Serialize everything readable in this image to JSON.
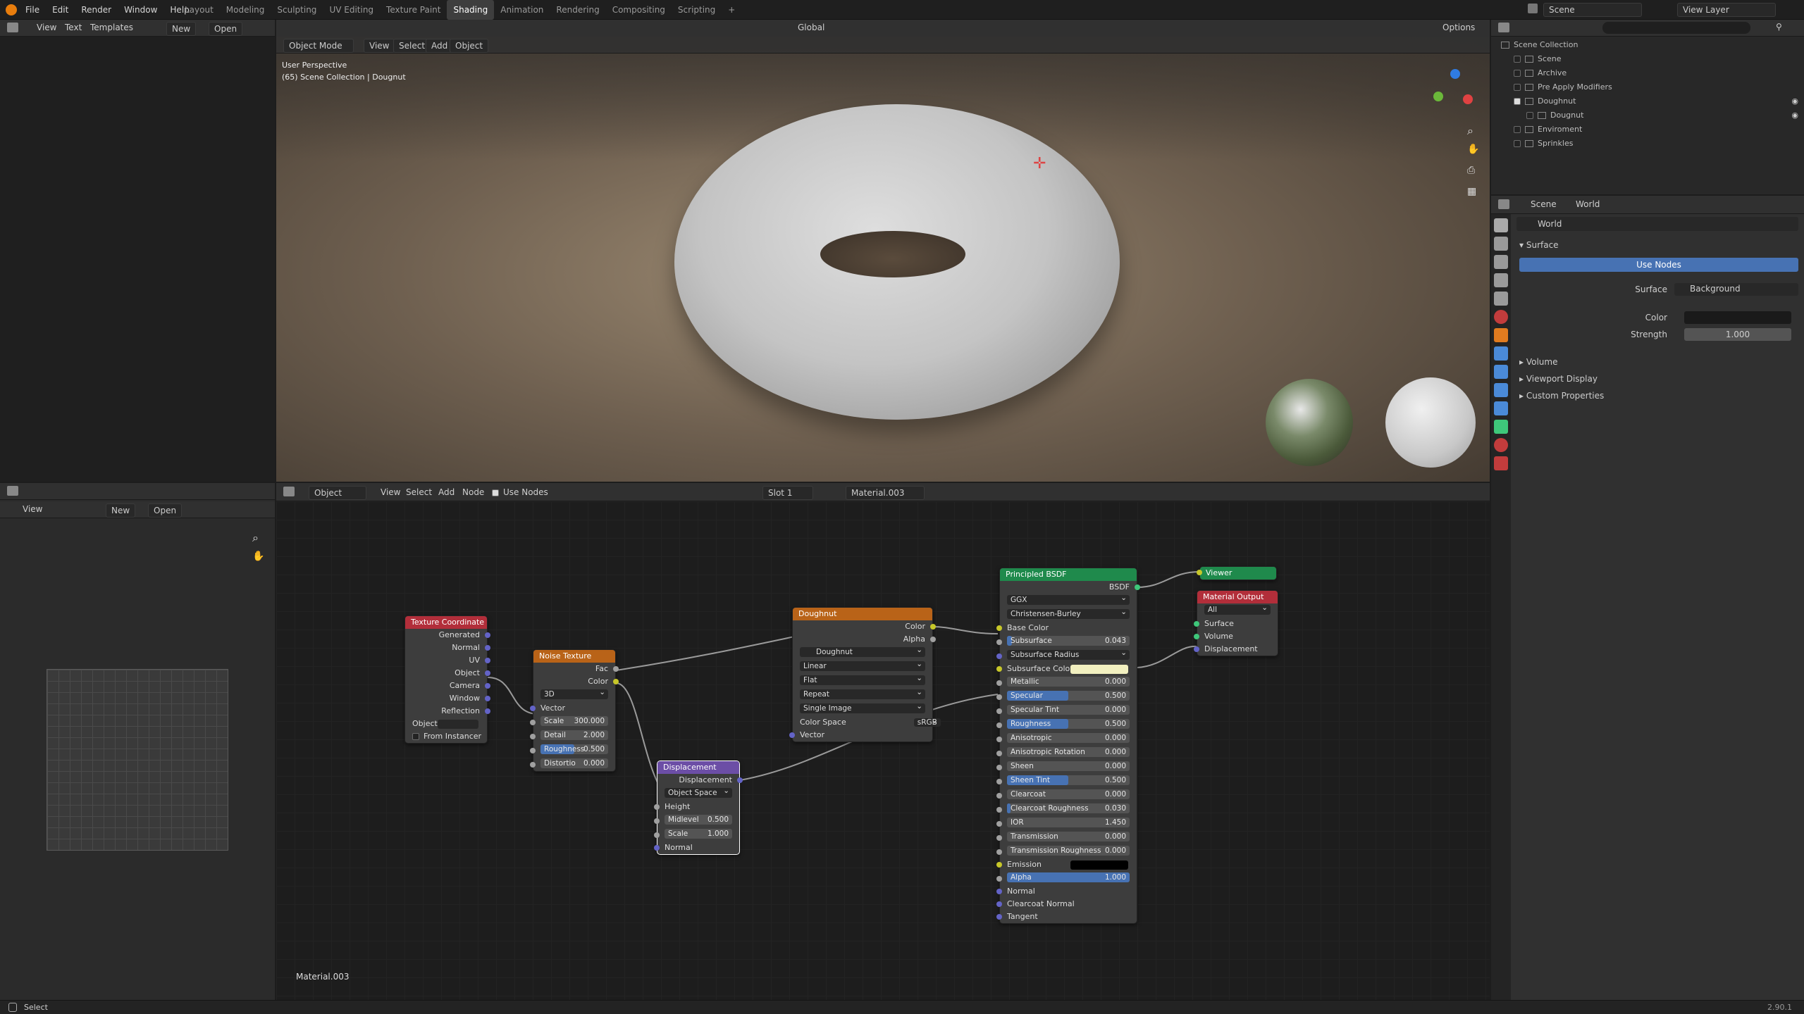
{
  "topbar": {
    "menu": [
      "File",
      "Edit",
      "Render",
      "Window",
      "Help"
    ],
    "workspaces": [
      "Layout",
      "Modeling",
      "Sculpting",
      "UV Editing",
      "Texture Paint",
      "Shading",
      "Animation",
      "Rendering",
      "Compositing",
      "Scripting"
    ],
    "active_workspace": "Shading",
    "scene": "Scene",
    "view_layer": "View Layer"
  },
  "text_editor": {
    "menu": [
      "View",
      "Text",
      "Templates"
    ],
    "new": "New",
    "open": "Open"
  },
  "viewport": {
    "mode": "Object Mode",
    "menu": [
      "View",
      "Select",
      "Add",
      "Object"
    ],
    "transform": "Global",
    "options": "Options",
    "info_line1": "User Perspective",
    "info_line2": "(65) Scene Collection | Dougnut"
  },
  "image_editor": {
    "view": "View",
    "new": "New",
    "open": "Open"
  },
  "node_editor": {
    "object": "Object",
    "menu": [
      "View",
      "Select",
      "Add",
      "Node"
    ],
    "use_nodes": "Use Nodes",
    "slot": "Slot 1",
    "material": "Material.003",
    "footer_label": "Material.003"
  },
  "nodes": {
    "tex_coord": {
      "title": "Texture Coordinate",
      "outputs": [
        "Generated",
        "Normal",
        "UV",
        "Object",
        "Camera",
        "Window",
        "Reflection"
      ],
      "object_label": "Object",
      "from_instancer": "From Instancer"
    },
    "noise": {
      "title": "Noise Texture",
      "outputs": [
        "Fac",
        "Color"
      ],
      "dim": "3D",
      "vector": "Vector",
      "scale_l": "Scale",
      "scale_v": "300.000",
      "detail_l": "Detail",
      "detail_v": "2.000",
      "rough_l": "Roughness",
      "rough_v": "0.500",
      "dist_l": "Distortio",
      "dist_v": "0.000"
    },
    "image": {
      "title": "Doughnut",
      "outputs": [
        "Color",
        "Alpha"
      ],
      "image_name": "Doughnut",
      "interp": "Linear",
      "proj": "Flat",
      "ext": "Repeat",
      "source": "Single Image",
      "cs_label": "Color Space",
      "cs_value": "sRGB",
      "vector": "Vector"
    },
    "displacement": {
      "title": "Displacement",
      "output": "Displacement",
      "space": "Object Space",
      "height": "Height",
      "mid_l": "Midlevel",
      "mid_v": "0.500",
      "scale_l": "Scale",
      "scale_v": "1.000",
      "normal": "Normal"
    },
    "bsdf": {
      "title": "Principled BSDF",
      "output": "BSDF",
      "dist": "GGX",
      "sss": "Christensen-Burley",
      "base_color": "Base Color",
      "rows": [
        {
          "l": "Subsurface",
          "v": "0.043",
          "f": 0.04
        },
        {
          "l": "Subsurface Radius",
          "drop": true
        },
        {
          "l": "Subsurface Color",
          "swatch": "#f2f0c0"
        },
        {
          "l": "Metallic",
          "v": "0.000",
          "f": 0
        },
        {
          "l": "Specular",
          "v": "0.500",
          "f": 0.5
        },
        {
          "l": "Specular Tint",
          "v": "0.000",
          "f": 0
        },
        {
          "l": "Roughness",
          "v": "0.500",
          "f": 0.5
        },
        {
          "l": "Anisotropic",
          "v": "0.000",
          "f": 0
        },
        {
          "l": "Anisotropic Rotation",
          "v": "0.000",
          "f": 0
        },
        {
          "l": "Sheen",
          "v": "0.000",
          "f": 0
        },
        {
          "l": "Sheen Tint",
          "v": "0.500",
          "f": 0.5
        },
        {
          "l": "Clearcoat",
          "v": "0.000",
          "f": 0
        },
        {
          "l": "Clearcoat Roughness",
          "v": "0.030",
          "f": 0.03
        },
        {
          "l": "IOR",
          "v": "1.450",
          "f": 0
        },
        {
          "l": "Transmission",
          "v": "0.000",
          "f": 0
        },
        {
          "l": "Transmission Roughness",
          "v": "0.000",
          "f": 0
        },
        {
          "l": "Emission",
          "swatch": "#000000"
        },
        {
          "l": "Alpha",
          "v": "1.000",
          "f": 1
        }
      ],
      "tail": [
        "Normal",
        "Clearcoat Normal",
        "Tangent"
      ]
    },
    "viewer": {
      "title": "Viewer"
    },
    "output": {
      "title": "Material Output",
      "target": "All",
      "inputs": [
        "Surface",
        "Volume",
        "Displacement"
      ]
    }
  },
  "outliner": {
    "items": [
      {
        "name": "Scene Collection",
        "indent": 0
      },
      {
        "name": "Scene",
        "indent": 1
      },
      {
        "name": "Archive",
        "indent": 1
      },
      {
        "name": "Pre Apply Modifiers",
        "indent": 1
      },
      {
        "name": "Doughnut",
        "indent": 1,
        "checked": true
      },
      {
        "name": "Dougnut",
        "indent": 2
      },
      {
        "name": "Enviroment",
        "indent": 1
      },
      {
        "name": "Sprinkles",
        "indent": 1
      }
    ]
  },
  "properties": {
    "crumb_scene": "Scene",
    "crumb_world": "World",
    "world_name": "World",
    "surface_section": "Surface",
    "use_nodes": "Use Nodes",
    "surface_label": "Surface",
    "surface_value": "Background",
    "color_label": "Color",
    "strength_label": "Strength",
    "strength_value": "1.000",
    "sections": [
      "Volume",
      "Viewport Display",
      "Custom Properties"
    ]
  },
  "statusbar": {
    "select": "Select",
    "version": "2.90.1"
  }
}
